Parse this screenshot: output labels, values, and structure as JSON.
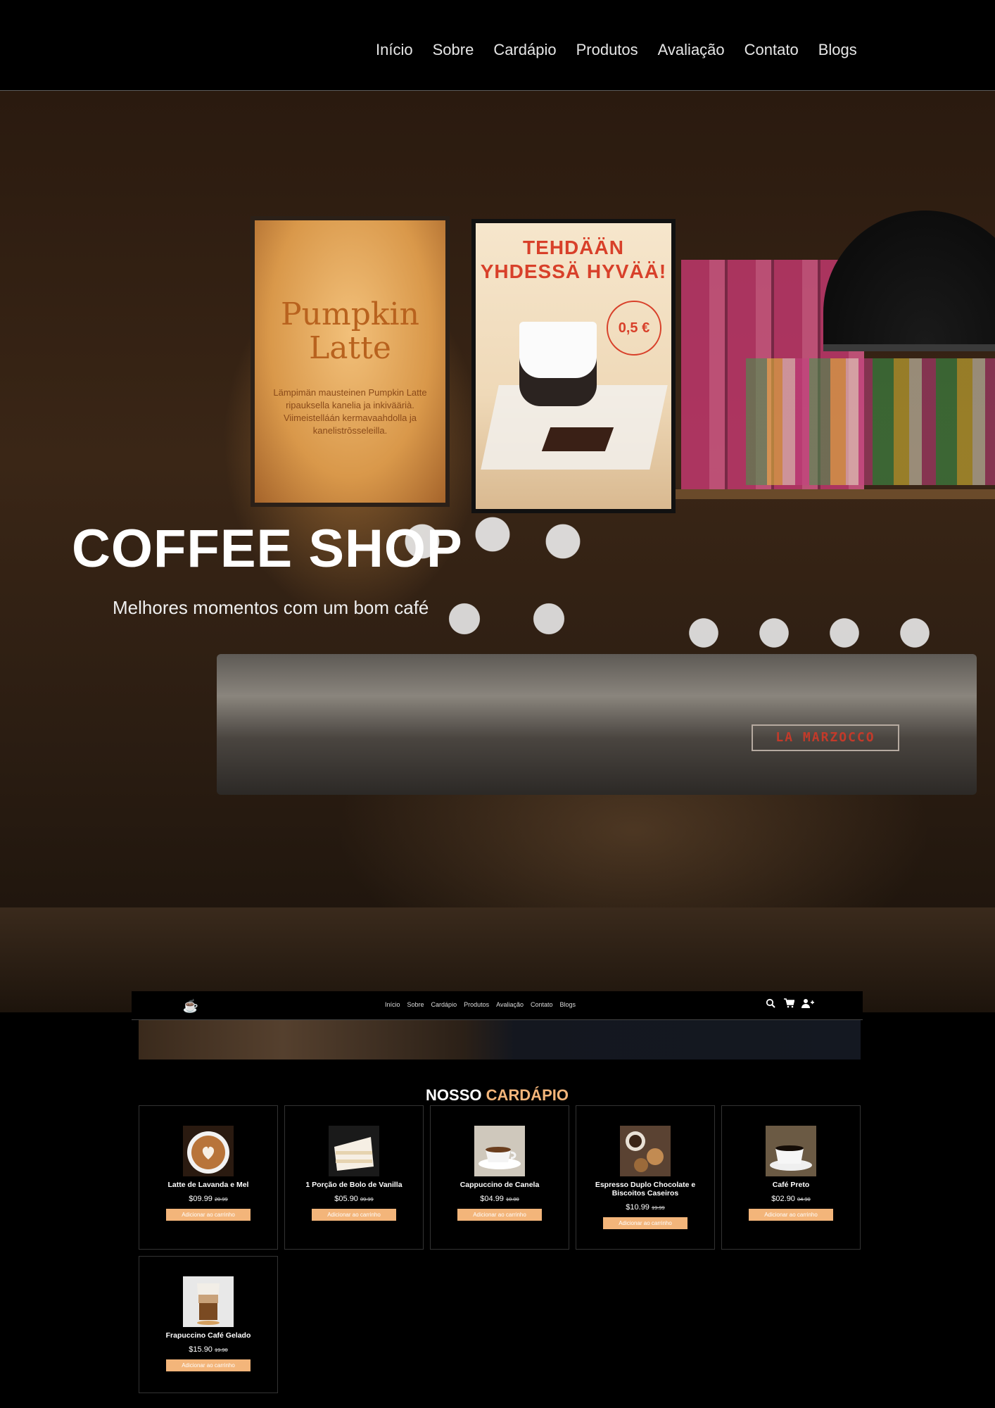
{
  "top_nav": {
    "items": [
      "Início",
      "Sobre",
      "Cardápio",
      "Produtos",
      "Avaliação",
      "Contato",
      "Blogs"
    ]
  },
  "hero": {
    "title": "COFFEE SHOP",
    "subtitle": "Melhores momentos com um bom café",
    "poster_pumpkin_title": "Pumpkin Latte",
    "poster_pumpkin_text": "Lämpimän mausteinen Pumpkin Latte ripauksella kanelia ja inkiväärià. Viimeistelláán kermavaahdolla ja kanelistrōsseleilla.",
    "poster_tehdaan_title": "TEHDÄÄN YHDESSÄ HYVÄÄ!",
    "poster_tehdaan_price": "0,5 €",
    "machine_brand": "LA MARZOCCO"
  },
  "embedded": {
    "logo_icon": "coffee-cup-icon",
    "nav": [
      "Início",
      "Sobre",
      "Cardápio",
      "Produtos",
      "Avaliação",
      "Contato",
      "Blogs"
    ],
    "icons": [
      "search-icon",
      "cart-icon",
      "user-plus-icon"
    ],
    "menu_title": {
      "prefix": "NOSSO",
      "accent": "CARDÁPIO"
    },
    "accent_color": "#f3b57a",
    "button_label": "Adicionar ao carrinho",
    "products": [
      {
        "name": "Latte de Lavanda e Mel",
        "price": "$09.99",
        "old_price": "20.99"
      },
      {
        "name": "1 Porção de Bolo de Vanilla",
        "price": "$05.90",
        "old_price": "09.99"
      },
      {
        "name": "Cappuccino de Canela",
        "price": "$04.99",
        "old_price": "10.00"
      },
      {
        "name": "Espresso Duplo Chocolate e Biscoitos Caseiros",
        "price": "$10.99",
        "old_price": "19.99"
      },
      {
        "name": "Café Preto",
        "price": "$02.90",
        "old_price": "04.90"
      },
      {
        "name": "Frapuccino Café Gelado",
        "price": "$15.90",
        "old_price": "19.90"
      }
    ]
  }
}
